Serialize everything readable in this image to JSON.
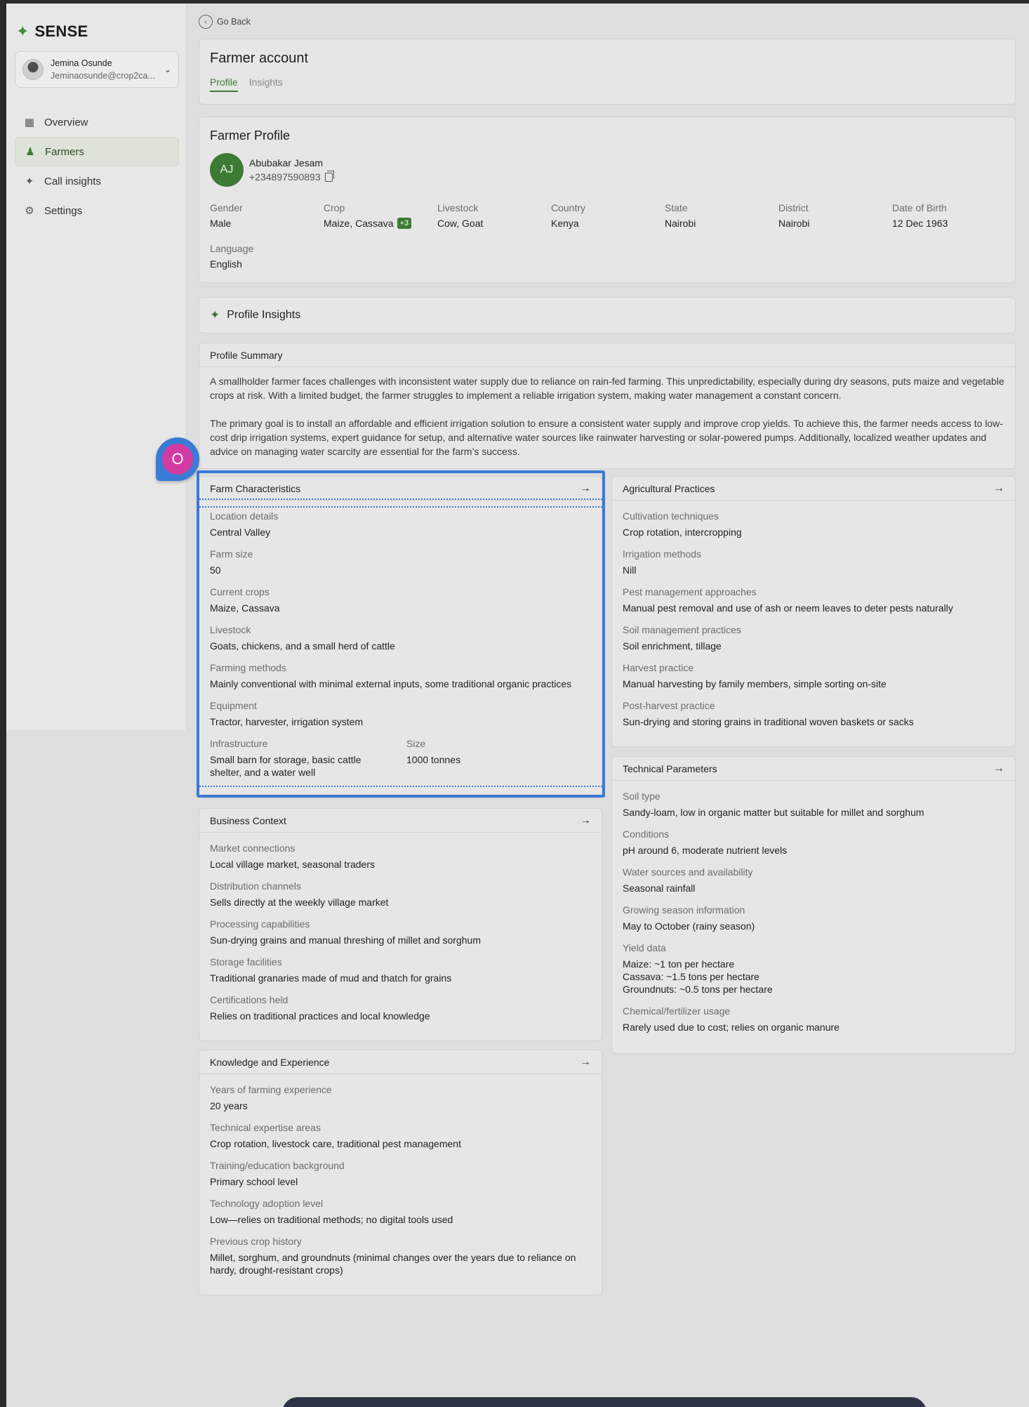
{
  "brand": {
    "name": "SENSE"
  },
  "user": {
    "name": "Jemina Osunde",
    "email": "Jeminaosunde@crop2ca..."
  },
  "nav": [
    {
      "label": "Overview",
      "icon": "grid-icon",
      "active": false
    },
    {
      "label": "Farmers",
      "icon": "farmer-icon",
      "active": true
    },
    {
      "label": "Call insights",
      "icon": "sparkle-icon",
      "active": false
    },
    {
      "label": "Settings",
      "icon": "gear-icon",
      "active": false
    }
  ],
  "back_label": "Go Back",
  "account": {
    "title": "Farmer account",
    "tabs": [
      "Profile",
      "Insights"
    ],
    "active_tab": "Profile"
  },
  "profile": {
    "title": "Farmer Profile",
    "initials": "AJ",
    "name": "Abubakar Jesam",
    "phone": "+234897590893",
    "fields": [
      {
        "label": "Gender",
        "value": "Male"
      },
      {
        "label": "Crop",
        "value": "Maize, Cassava",
        "badge": "+3"
      },
      {
        "label": "Livestock",
        "value": "Cow, Goat"
      },
      {
        "label": "Country",
        "value": "Kenya"
      },
      {
        "label": "State",
        "value": "Nairobi"
      },
      {
        "label": "District",
        "value": "Nairobi"
      },
      {
        "label": "Date of Birth",
        "value": "12 Dec 1963"
      },
      {
        "label": "Language",
        "value": "English"
      }
    ]
  },
  "insights": {
    "title": "Profile Insights"
  },
  "summary": {
    "title": "Profile Summary",
    "p1": "A smallholder farmer faces challenges with inconsistent water supply due to reliance on rain-fed farming. This unpredictability, especially during dry seasons, puts maize and vegetable crops at risk. With a limited budget, the farmer struggles to implement a reliable irrigation system, making water management a constant concern.",
    "p2": "The primary goal is to install an affordable and efficient irrigation solution to ensure a consistent water supply and improve crop yields. To achieve this, the farmer needs access to low-cost drip irrigation systems, expert guidance for setup, and alternative water sources like rainwater harvesting or solar-powered pumps. Additionally, localized weather updates and advice on managing water scarcity are essential for the farm’s success."
  },
  "farm_characteristics": {
    "title": "Farm Characteristics",
    "items": [
      {
        "k": "Location details",
        "v": "Central Valley"
      },
      {
        "k": "Farm size",
        "v": "50"
      },
      {
        "k": "Current crops",
        "v": "Maize, Cassava"
      },
      {
        "k": "Livestock",
        "v": "Goats, chickens, and a small herd of cattle"
      },
      {
        "k": "Farming methods",
        "v": "Mainly conventional with minimal external inputs, some traditional organic practices"
      },
      {
        "k": "Equipment",
        "v": "Tractor, harvester, irrigation system"
      }
    ],
    "infra": {
      "k": "Infrastructure",
      "v": "Small barn for storage, basic cattle shelter, and a water well"
    },
    "size": {
      "k": "Size",
      "v": "1000 tonnes"
    }
  },
  "agricultural_practices": {
    "title": "Agricultural Practices",
    "items": [
      {
        "k": "Cultivation techniques",
        "v": "Crop rotation, intercropping"
      },
      {
        "k": "Irrigation methods",
        "v": "Nill"
      },
      {
        "k": "Pest management approaches",
        "v": "Manual pest removal and use of ash or neem leaves to deter pests naturally"
      },
      {
        "k": "Soil management practices",
        "v": "Soil enrichment, tillage"
      },
      {
        "k": "Harvest practice",
        "v": "Manual harvesting by family members, simple sorting on-site"
      },
      {
        "k": "Post-harvest practice",
        "v": "Sun-drying and storing grains in traditional woven baskets or sacks"
      }
    ]
  },
  "technical_parameters": {
    "title": "Technical Parameters",
    "items": [
      {
        "k": "Soil type",
        "v": "Sandy-loam, low in organic matter but suitable for millet and sorghum"
      },
      {
        "k": "Conditions",
        "v": "pH around 6, moderate nutrient levels"
      },
      {
        "k": "Water sources and availability",
        "v": "Seasonal rainfall"
      },
      {
        "k": "Growing season information",
        "v": "May to October (rainy season)"
      }
    ],
    "yield": {
      "k": "Yield data",
      "lines": [
        "Maize: ~1 ton per hectare",
        "Cassava: ~1.5 tons per hectare",
        "Groundnuts: ~0.5 tons per hectare"
      ]
    },
    "chem": {
      "k": "Chemical/fertilizer usage",
      "v": "Rarely used due to cost; relies on organic manure"
    }
  },
  "business_context": {
    "title": "Business Context",
    "items": [
      {
        "k": "Market connections",
        "v": "Local village market, seasonal traders"
      },
      {
        "k": "Distribution channels",
        "v": "Sells directly at the weekly village market"
      },
      {
        "k": "Processing capabilities",
        "v": "Sun-drying grains and manual threshing of millet and sorghum"
      },
      {
        "k": "Storage facilities",
        "v": "Traditional granaries made of mud and thatch for grains"
      },
      {
        "k": "Certifications held",
        "v": "Relies on traditional practices and local knowledge"
      }
    ]
  },
  "knowledge": {
    "title": "Knowledge and Experience",
    "items": [
      {
        "k": "Years of farming experience",
        "v": "20 years"
      },
      {
        "k": "Technical expertise areas",
        "v": "Crop rotation, livestock care, traditional pest management"
      },
      {
        "k": "Training/education background",
        "v": "Primary school level"
      },
      {
        "k": "Technology adoption level",
        "v": "Low—relies on traditional methods; no digital tools used"
      },
      {
        "k": "Previous crop history",
        "v": "Millet, sorghum, and groundnuts (minimal changes over the years due to reliance on hardy, drought-resistant crops)"
      }
    ]
  },
  "cursor": {
    "letter": "O"
  },
  "colors": {
    "accent": "#3d7a35",
    "selection": "#3a7bd5",
    "cursor": "#d43ba2"
  }
}
